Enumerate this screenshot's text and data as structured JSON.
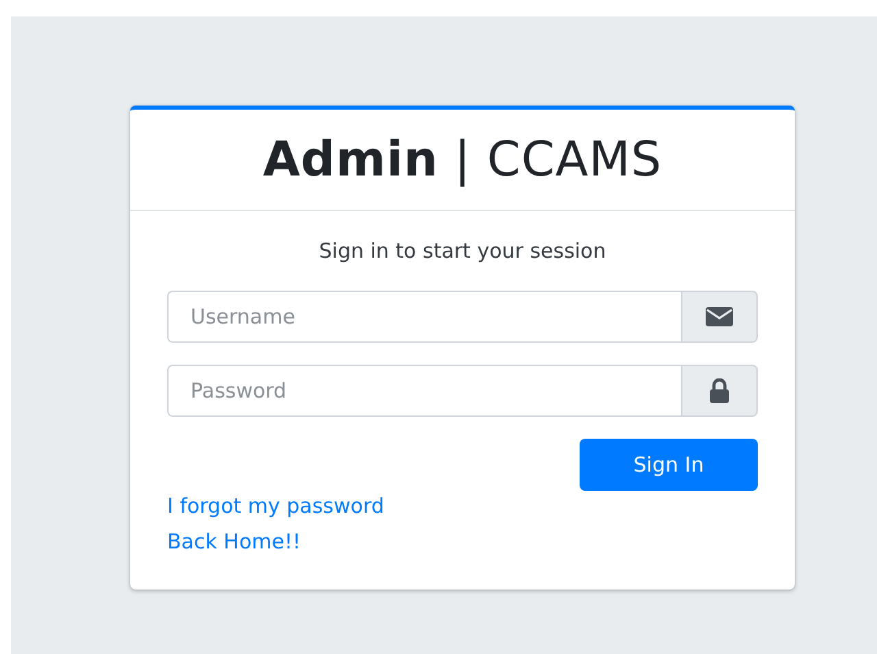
{
  "logo": "**Admin** | CCAMS",
  "message": "Sign in to start your session",
  "fields": [
    {
      "kind": "email",
      "placeholder": "Username"
    },
    {
      "kind": "password",
      "placeholder": "Password"
    }
  ],
  "submit": "Sign In",
  "links": [
    "I forgot my password",
    "Back Home!!"
  ]
}
